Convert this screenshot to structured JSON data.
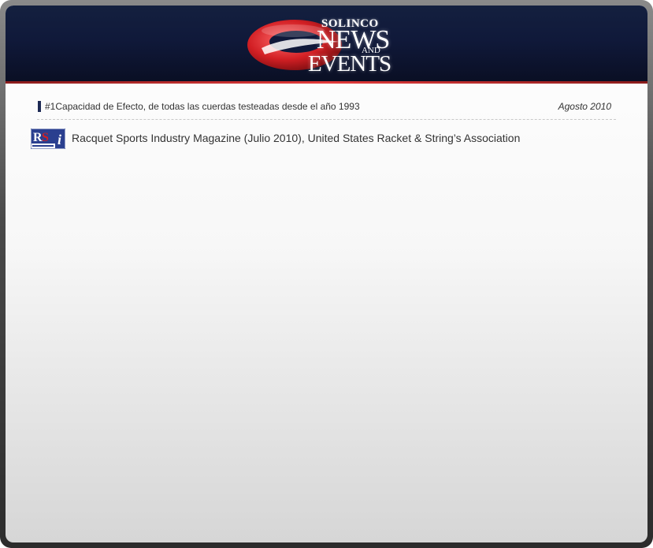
{
  "header": {
    "brand": "SOLINCO",
    "title_line1": "NEWS",
    "title_and": "AND",
    "title_line2": "EVENTS",
    "colors": {
      "background": "#10193a",
      "accent_red": "#d32f2f",
      "text": "#ffffff"
    }
  },
  "news_item": {
    "headline": "#1Capacidad de Efecto, de todas las cuerdas testeadas desde el año 1993",
    "date": "Agosto 2010",
    "source_logo": {
      "letters": "RSi",
      "caption": "Racquet Sports Industry",
      "icon": "rsi-logo-icon"
    },
    "source": "Racquet Sports Industry Magazine (Julio 2010), United States Racket & String’s Association"
  }
}
